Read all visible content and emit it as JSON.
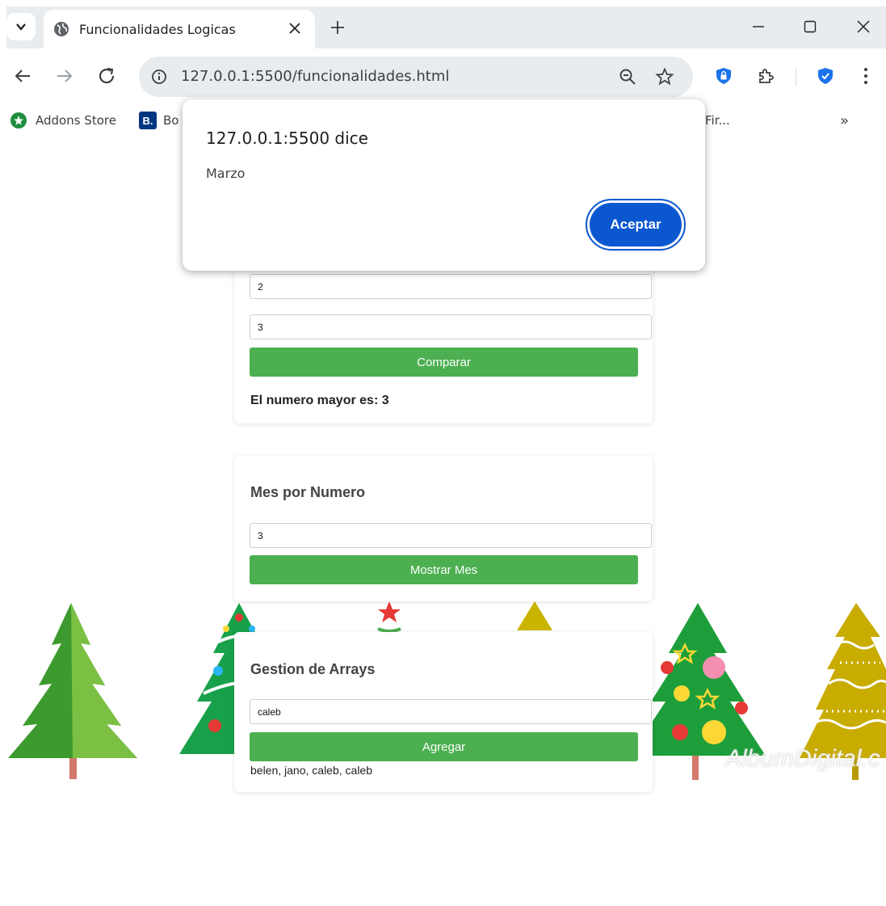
{
  "browser": {
    "tab_title": "Funcionalidades Logicas",
    "url": "127.0.0.1:5500/funcionalidades.html",
    "bookmarks": [
      {
        "label": "Addons Store"
      },
      {
        "label": "Bo"
      },
      {
        "label": "Fir..."
      }
    ],
    "overflow_label": "»"
  },
  "dialog": {
    "title": "127.0.0.1:5500 dice",
    "message": "Marzo",
    "ok_label": "Aceptar"
  },
  "comparar": {
    "input1_value": "2",
    "input2_value": "3",
    "button_label": "Comparar",
    "result": "El numero mayor es: 3"
  },
  "mes": {
    "title": "Mes por Numero",
    "input_value": "3",
    "button_label": "Mostrar Mes"
  },
  "arrays": {
    "title": "Gestion de Arrays",
    "input_value": "caleb",
    "button_label": "Agregar",
    "list": "belen, jano, caleb, caleb"
  },
  "watermark": "AlbumDigital.c",
  "colors": {
    "button_green": "#4caf50",
    "dialog_blue": "#0b57d0",
    "chrome_gray": "#e9ecef"
  }
}
